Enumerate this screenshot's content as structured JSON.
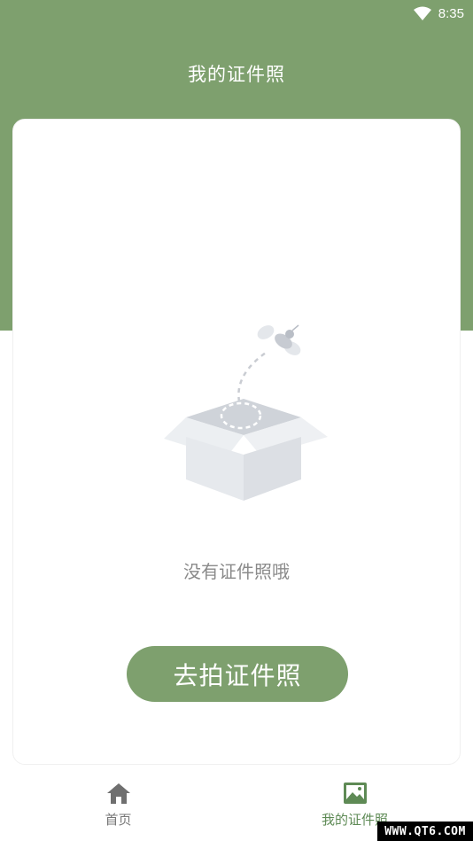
{
  "status_bar": {
    "time": "8:35",
    "wifi_icon": "wifi-icon"
  },
  "header": {
    "title": "我的证件照"
  },
  "empty_state": {
    "illustration": "empty-box-with-bee",
    "message": "没有证件照哦",
    "action_label": "去拍证件照"
  },
  "bottom_nav": {
    "items": [
      {
        "label": "首页",
        "icon": "home-icon",
        "active": false
      },
      {
        "label": "我的证件照",
        "icon": "image-icon",
        "active": true
      }
    ]
  },
  "watermark": "WWW.QT6.COM",
  "colors": {
    "primary": "#7ea06e",
    "active_label": "#5e8a55",
    "inactive": "#777777",
    "background": "#ffffff"
  }
}
